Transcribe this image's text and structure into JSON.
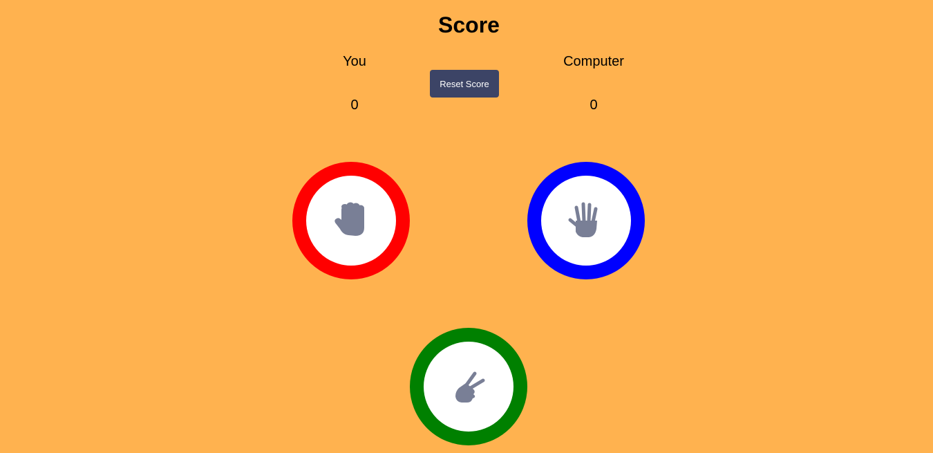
{
  "header": {
    "title": "Score"
  },
  "scoreboard": {
    "player": {
      "label": "You",
      "score": "0"
    },
    "computer": {
      "label": "Computer",
      "score": "0"
    },
    "reset_label": "Reset Score"
  },
  "choices": [
    {
      "name": "rock",
      "icon": "fist-hand-icon",
      "ring_color": "#FF0000"
    },
    {
      "name": "paper",
      "icon": "open-hand-icon",
      "ring_color": "#0000FF"
    },
    {
      "name": "scissors",
      "icon": "scissors-hand-icon",
      "ring_color": "#008000"
    }
  ],
  "colors": {
    "background": "#FFB24F",
    "button": "#3C4466",
    "icon": "#797F96"
  }
}
